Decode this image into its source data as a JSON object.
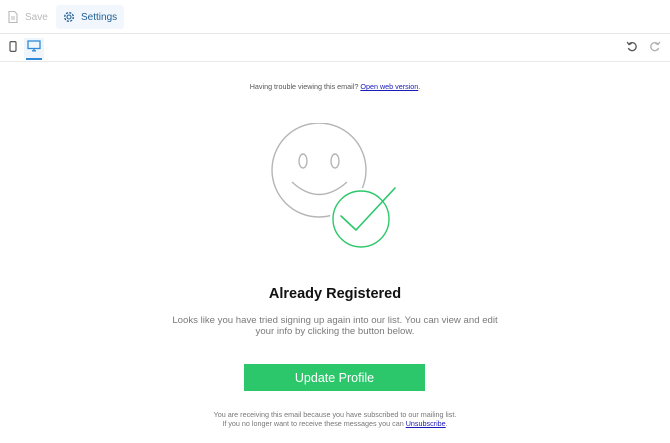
{
  "toolbar": {
    "save_label": "Save",
    "settings_label": "Settings",
    "accent_color": "#1f5f95"
  },
  "view_modes": {
    "mobile_icon": "mobile-icon",
    "desktop_icon": "desktop-icon",
    "active": "desktop"
  },
  "history": {
    "undo_icon": "undo-icon",
    "redo_icon": "redo-icon"
  },
  "email": {
    "trouble_text": "Having trouble viewing this email?",
    "web_version_link": "Open web version",
    "period": ".",
    "illustration": "smiley-face-with-checkmark",
    "check_color": "#2cc76a",
    "heading": "Already Registered",
    "description_line1": "Looks like you have tried signing up again into our list. You can view and edit",
    "description_line2": "your info by clicking the button below.",
    "button_label": "Update Profile",
    "button_color": "#2cc76a",
    "footer_line1": "You are receiving this email because you have subscribed to our mailing list.",
    "footer_line2": "If you no longer want to receive these messages you can",
    "unsubscribe_link": "Unsubscribe",
    "footer_period": "."
  }
}
